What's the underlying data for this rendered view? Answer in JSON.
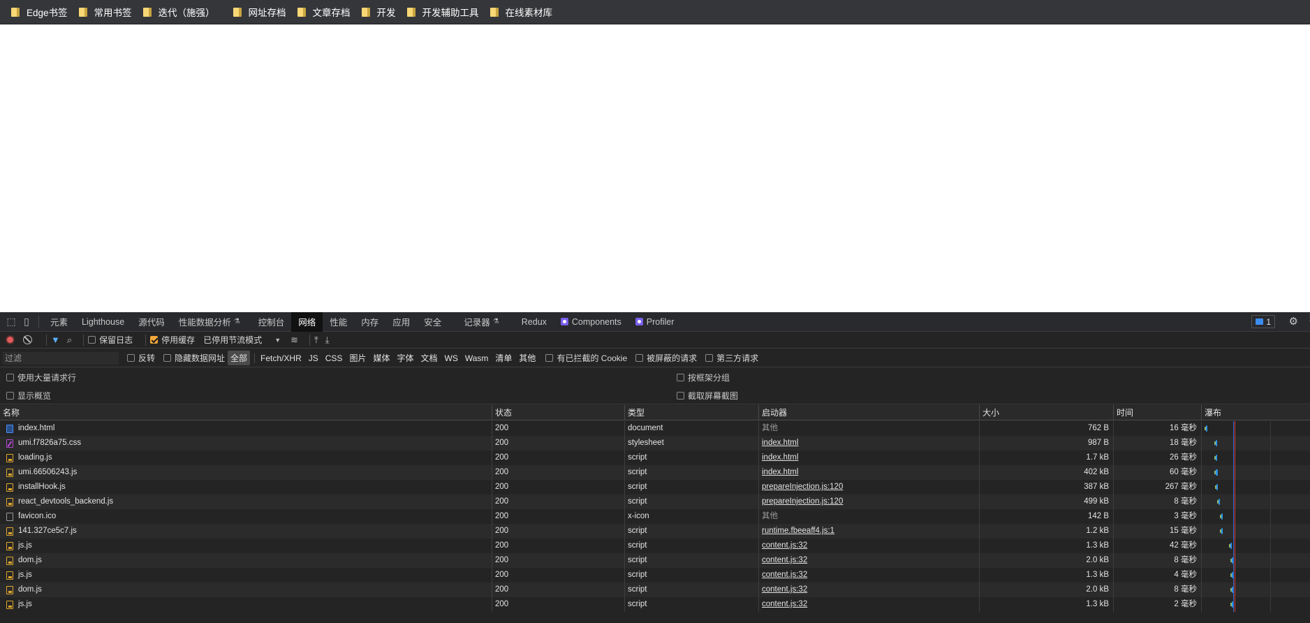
{
  "bookmarks": [
    {
      "label": "Edge书签"
    },
    {
      "label": "常用书签"
    },
    {
      "label": "迭代（施强）"
    },
    {
      "label": "网址存档"
    },
    {
      "label": "文章存档"
    },
    {
      "label": "开发"
    },
    {
      "label": "开发辅助工具"
    },
    {
      "label": "在线素材库"
    }
  ],
  "devtools": {
    "tabs": [
      {
        "label": "元素"
      },
      {
        "label": "Lighthouse"
      },
      {
        "label": "源代码"
      },
      {
        "label": "性能数据分析"
      },
      {
        "label": "控制台"
      },
      {
        "label": "网络"
      },
      {
        "label": "性能"
      },
      {
        "label": "内存"
      },
      {
        "label": "应用"
      },
      {
        "label": "安全"
      },
      {
        "label": "记录器"
      },
      {
        "label": "Redux"
      },
      {
        "label": "Components"
      },
      {
        "label": "Profiler"
      }
    ],
    "active_tab": "网络",
    "issues_count": "1",
    "toolbar": {
      "preserve_log": "保留日志",
      "disable_cache": "停用缓存",
      "throttling": "已停用节流模式"
    },
    "filter": {
      "placeholder": "过滤",
      "invert": "反转",
      "hide_data_urls": "隐藏数据网址",
      "types": [
        "全部",
        "Fetch/XHR",
        "JS",
        "CSS",
        "图片",
        "媒体",
        "字体",
        "文档",
        "WS",
        "Wasm",
        "清单",
        "其他"
      ],
      "selected_type": "全部",
      "blocked_cookies": "有已拦截的 Cookie",
      "blocked_requests": "被屏蔽的请求",
      "third_party": "第三方请求"
    },
    "options": {
      "big_rows": "使用大量请求行",
      "show_overview": "显示概览",
      "group_by_frame": "按框架分组",
      "capture_screenshots": "截取屏幕截图"
    },
    "columns": [
      "名称",
      "状态",
      "类型",
      "启动器",
      "大小",
      "时间",
      "瀑布"
    ],
    "requests": [
      {
        "name": "index.html",
        "icon": "doc",
        "status": "200",
        "type": "document",
        "initiator": "其他",
        "initiator_link": false,
        "size": "762 B",
        "time": "16 毫秒",
        "wf_start": 0.0,
        "wf_len": 0.16
      },
      {
        "name": "umi.f7826a75.css",
        "icon": "css",
        "status": "200",
        "type": "stylesheet",
        "initiator": "index.html",
        "initiator_link": true,
        "size": "987 B",
        "time": "18 毫秒",
        "wf_start": 0.27,
        "wf_len": 0.18
      },
      {
        "name": "loading.js",
        "icon": "js",
        "status": "200",
        "type": "script",
        "initiator": "index.html",
        "initiator_link": true,
        "size": "1.7 kB",
        "time": "26 毫秒",
        "wf_start": 0.27,
        "wf_len": 0.26
      },
      {
        "name": "umi.66506243.js",
        "icon": "js",
        "status": "200",
        "type": "script",
        "initiator": "index.html",
        "initiator_link": true,
        "size": "402 kB",
        "time": "60 毫秒",
        "wf_start": 0.27,
        "wf_len": 0.6
      },
      {
        "name": "installHook.js",
        "icon": "js",
        "status": "200",
        "type": "script",
        "initiator": "prepareInjection.js:120",
        "initiator_link": true,
        "size": "387 kB",
        "time": "267 毫秒",
        "wf_start": 0.28,
        "wf_len": 0.35
      },
      {
        "name": "react_devtools_backend.js",
        "icon": "js",
        "status": "200",
        "type": "script",
        "initiator": "prepareInjection.js:120",
        "initiator_link": true,
        "size": "499 kB",
        "time": "8 毫秒",
        "wf_start": 0.35,
        "wf_len": 0.08
      },
      {
        "name": "favicon.ico",
        "icon": "ico",
        "status": "200",
        "type": "x-icon",
        "initiator": "其他",
        "initiator_link": false,
        "size": "142 B",
        "time": "3 毫秒",
        "wf_start": 0.42,
        "wf_len": 0.06
      },
      {
        "name": "141.327ce5c7.js",
        "icon": "js",
        "status": "200",
        "type": "script",
        "initiator": "runtime.fbeeaff4.js:1",
        "initiator_link": true,
        "size": "1.2 kB",
        "time": "15 毫秒",
        "wf_start": 0.43,
        "wf_len": 0.15
      },
      {
        "name": "js.js",
        "icon": "js",
        "status": "200",
        "type": "script",
        "initiator": "content.js:32",
        "initiator_link": true,
        "size": "1.3 kB",
        "time": "42 毫秒",
        "wf_start": 0.67,
        "wf_len": 0.15
      },
      {
        "name": "dom.js",
        "icon": "js",
        "status": "200",
        "type": "script",
        "initiator": "content.js:32",
        "initiator_link": true,
        "size": "2.0 kB",
        "time": "8 毫秒",
        "wf_start": 0.71,
        "wf_len": 0.08
      },
      {
        "name": "js.js",
        "icon": "js",
        "status": "200",
        "type": "script",
        "initiator": "content.js:32",
        "initiator_link": true,
        "size": "1.3 kB",
        "time": "4 毫秒",
        "wf_start": 0.72,
        "wf_len": 0.06
      },
      {
        "name": "dom.js",
        "icon": "js",
        "status": "200",
        "type": "script",
        "initiator": "content.js:32",
        "initiator_link": true,
        "size": "2.0 kB",
        "time": "8 毫秒",
        "wf_start": 0.72,
        "wf_len": 0.08
      },
      {
        "name": "js.js",
        "icon": "js",
        "status": "200",
        "type": "script",
        "initiator": "content.js:32",
        "initiator_link": true,
        "size": "1.3 kB",
        "time": "2 毫秒",
        "wf_start": 0.72,
        "wf_len": 0.04
      }
    ]
  },
  "colors": {
    "accent_blue": "#2a92e8",
    "checkbox_orange": "#f2a83b",
    "record_red": "#e35c5c"
  }
}
